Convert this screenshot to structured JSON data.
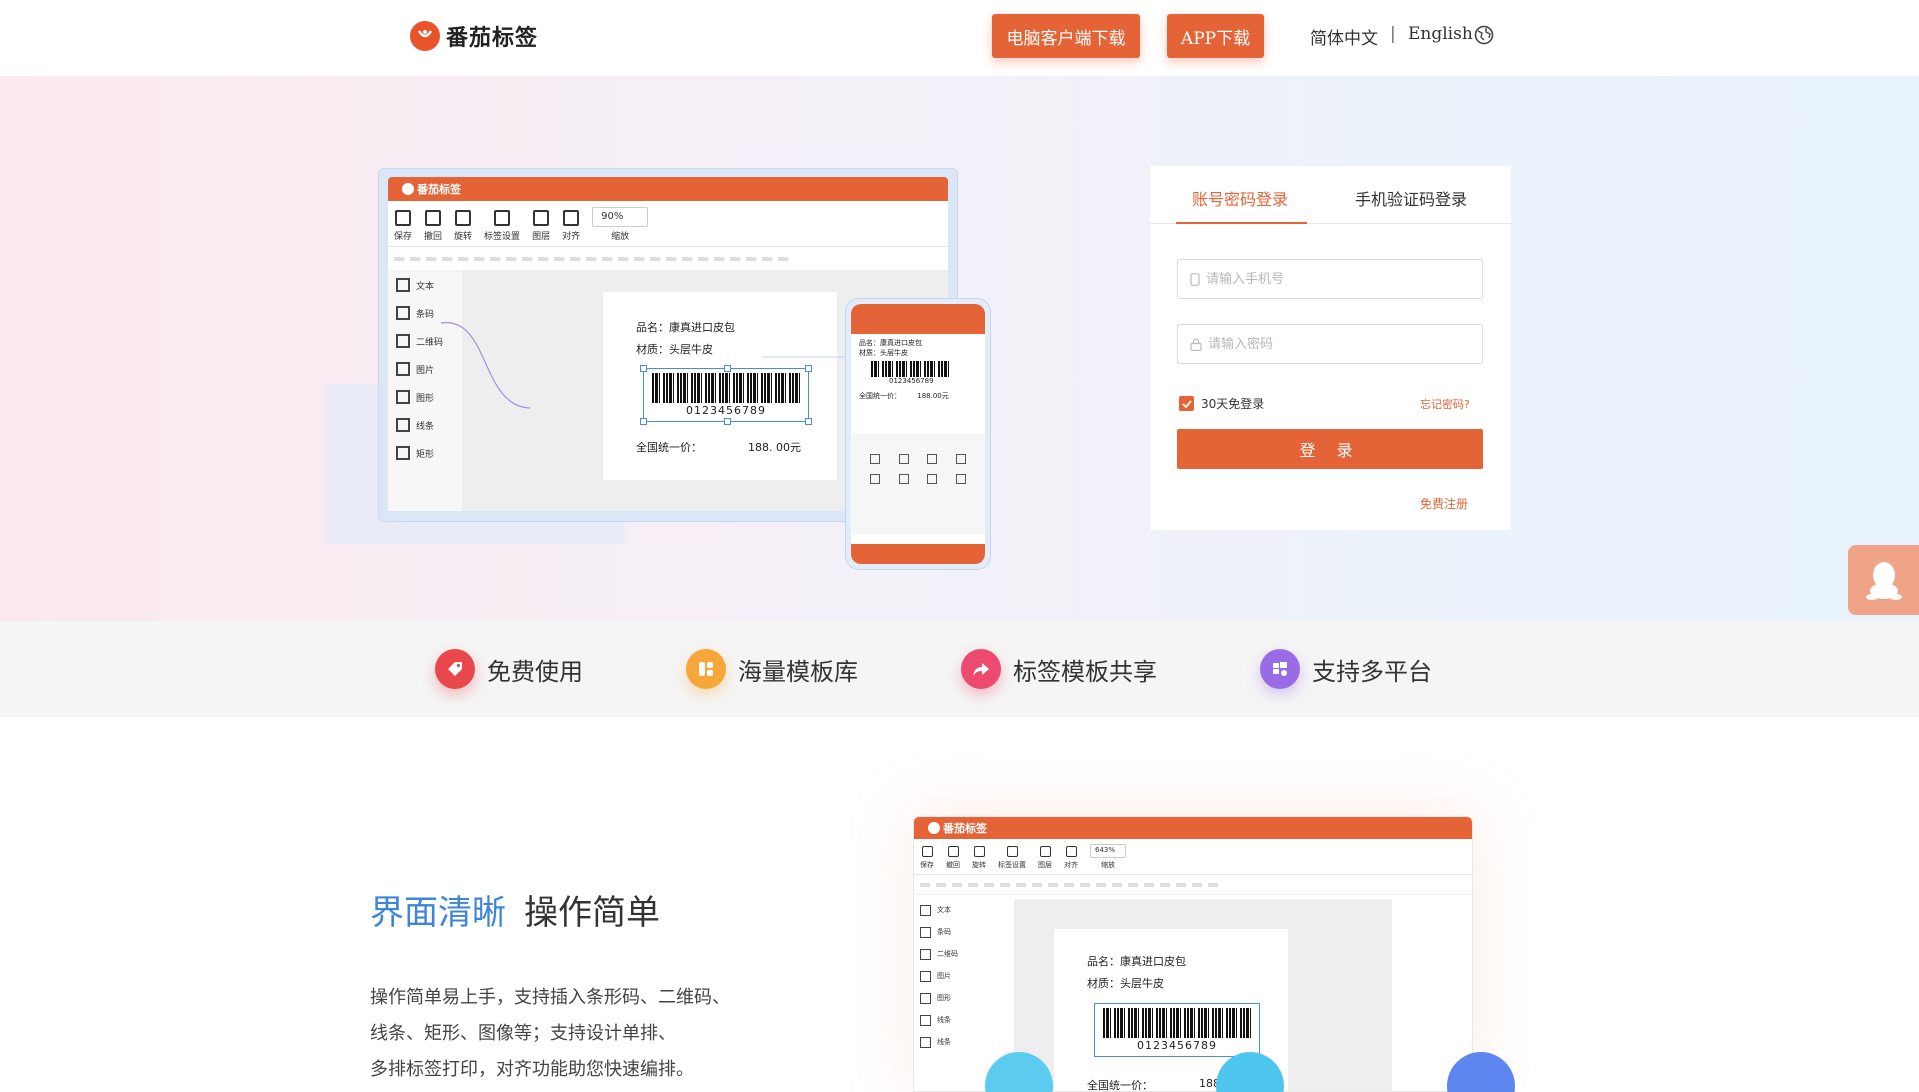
{
  "header": {
    "brand": "番茄标签",
    "download_pc": "电脑客户端下载",
    "download_app": "APP下载",
    "lang_cn": "简体中文",
    "lang_sep": "|",
    "lang_en": "English",
    "globe_icon": "globe-icon"
  },
  "hero_preview": {
    "app_title": "番茄标签",
    "toolbar": [
      "保存",
      "撤回",
      "旋转",
      "标签设置",
      "图层",
      "对齐",
      "缩放"
    ],
    "zoom_value": "90%",
    "sidebar": [
      "文本",
      "条码",
      "二维码",
      "图片",
      "图形",
      "线条",
      "矩形"
    ],
    "label_name": "品名：康真进口皮包",
    "label_material": "材质：头层牛皮",
    "barcode_number": "0123456789",
    "price_label": "全国统一价：",
    "price_value": "188. 00元",
    "phone_name": "品名：康真进口皮包",
    "phone_material": "材质：头层牛皮",
    "phone_barcode": "0123456789",
    "phone_price": "全国统一价：",
    "phone_price_value": "188.00元"
  },
  "login": {
    "tab_account": "账号密码登录",
    "tab_sms": "手机验证码登录",
    "phone_placeholder": "请输入手机号",
    "password_placeholder": "请输入密码",
    "remember_label": "30天免登录",
    "remember_checked": true,
    "forgot": "忘记密码?",
    "login_button": "登 录",
    "register": "免费注册"
  },
  "features": [
    {
      "label": "免费使用",
      "icon": "tag-icon",
      "color": "#e8484b"
    },
    {
      "label": "海量模板库",
      "icon": "grid-icon",
      "color": "#f7a63a"
    },
    {
      "label": "标签模板共享",
      "icon": "share-arrow-icon",
      "color": "#ec4a6e"
    },
    {
      "label": "支持多平台",
      "icon": "platforms-icon",
      "color": "#9a6be6"
    }
  ],
  "section": {
    "title_highlight": "界面清晰",
    "title_rest": "操作简单",
    "desc_line1": "操作简单易上手，支持插入条形码、二维码、",
    "desc_line2": "线条、矩形、图像等；支持设计单排、",
    "desc_line3": "多排标签打印，对齐功能助您快速编排。"
  },
  "section_preview": {
    "app_title": "番茄标签",
    "zoom_value": "643%",
    "sidebar": [
      "文本",
      "条码",
      "二维码",
      "图片",
      "图形",
      "线条",
      "线条"
    ],
    "label_name": "品名：康真进口皮包",
    "label_material": "材质：头层牛皮",
    "barcode_number": "0123456789",
    "price_label": "全国统一价：",
    "price_value": "188"
  },
  "colors": {
    "brand_orange": "#e46437",
    "link_blue": "#3d85d8",
    "hero_left": "#fbe9ef",
    "hero_right": "#e8f2fc"
  }
}
